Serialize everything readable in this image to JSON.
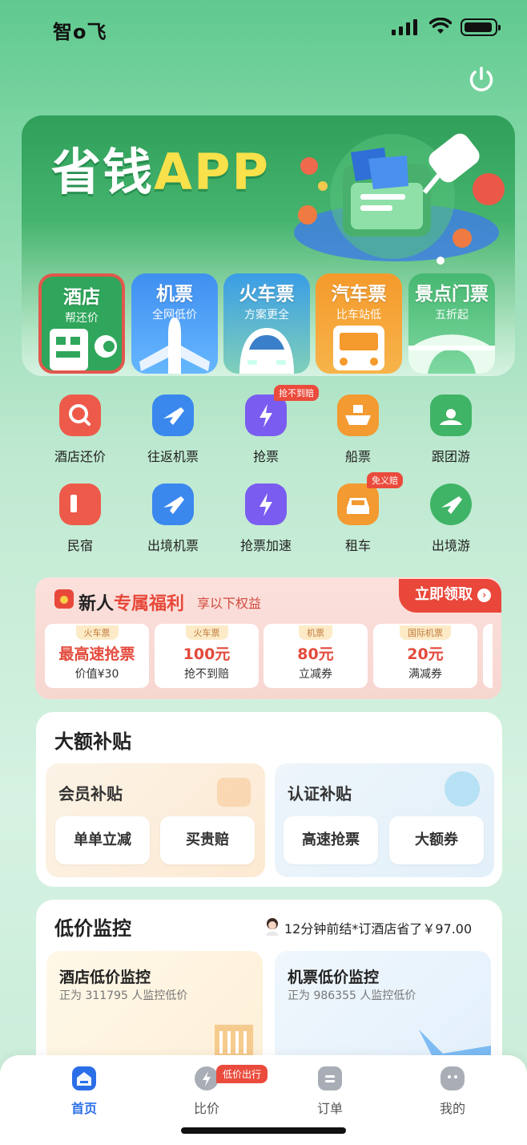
{
  "status_bar": {
    "carrier": "智o飞"
  },
  "banner": {
    "title_part1": "省钱",
    "title_part2": "APP"
  },
  "categories": [
    {
      "title": "酒店",
      "subtitle": "帮还价"
    },
    {
      "title": "机票",
      "subtitle": "全网低价"
    },
    {
      "title": "火车票",
      "subtitle": "方案更全"
    },
    {
      "title": "汽车票",
      "subtitle": "比车站低"
    },
    {
      "title": "景点门票",
      "subtitle": "五折起"
    }
  ],
  "grid": [
    {
      "label": "酒店还价",
      "tag": ""
    },
    {
      "label": "往返机票",
      "tag": ""
    },
    {
      "label": "抢票",
      "tag": "抢不到赔"
    },
    {
      "label": "船票",
      "tag": ""
    },
    {
      "label": "跟团游",
      "tag": ""
    },
    {
      "label": "民宿",
      "tag": ""
    },
    {
      "label": "出境机票",
      "tag": ""
    },
    {
      "label": "抢票加速",
      "tag": ""
    },
    {
      "label": "租车",
      "tag": "免义赔"
    },
    {
      "label": "出境游",
      "tag": ""
    }
  ],
  "new_user": {
    "title_part1": "新人",
    "title_part2": "专属福利",
    "subtitle": "享以下权益",
    "claim": "立即领取",
    "coupons": [
      {
        "type": "火车票",
        "value": "最高速抢票",
        "desc": "价值¥30"
      },
      {
        "type": "火车票",
        "value": "100元",
        "desc": "抢不到赔"
      },
      {
        "type": "机票",
        "value": "80元",
        "desc": "立减券"
      },
      {
        "type": "国际机票",
        "value": "20元",
        "desc": "满减券"
      }
    ]
  },
  "subsidy": {
    "title": "大额补贴",
    "member": {
      "title": "会员补贴",
      "buttons": [
        "单单立减",
        "买贵赔"
      ]
    },
    "verified": {
      "title": "认证补贴",
      "buttons": [
        "高速抢票",
        "大额券"
      ]
    }
  },
  "monitor": {
    "title": "低价监控",
    "note": "12分钟前结*订酒店省了￥97.00",
    "hotel": {
      "title": "酒店低价监控",
      "subtitle": "正为 311795 人监控低价"
    },
    "flight": {
      "title": "机票低价监控",
      "subtitle": "正为 986355 人监控低价"
    }
  },
  "tabbar": {
    "items": [
      {
        "label": "首页",
        "active": true
      },
      {
        "label": "比价",
        "active": false,
        "tag": "低价出行"
      },
      {
        "label": "订单",
        "active": false
      },
      {
        "label": "我的",
        "active": false
      }
    ],
    "accent": "#2b6fe8"
  }
}
